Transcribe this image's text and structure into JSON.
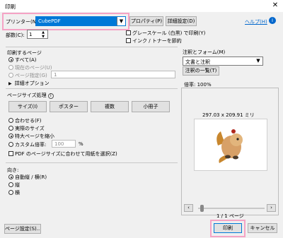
{
  "window": {
    "title": "印刷",
    "close_glyph": "✕"
  },
  "printer": {
    "label": "プリンター(N):",
    "value": "CubePDF",
    "properties": "プロパティ(P)",
    "advanced": "詳細設定(D)",
    "help": "ヘルプ(H)",
    "help_icon": "i"
  },
  "copies": {
    "label": "部数(C):",
    "value": "1"
  },
  "options": {
    "grayscale": "グレースケール (白黒) で印刷(Y)",
    "save_ink": "インク / トナーを節約"
  },
  "pages": {
    "section": "印刷するページ",
    "all": "すべて(A)",
    "current": "現在のページ(U)",
    "range": "ページ指定(G)",
    "range_value": "1",
    "more": "詳細オプション"
  },
  "sizing": {
    "section": "ページサイズ処理",
    "info_icon": "i",
    "tabs": [
      "サイズ(I)",
      "ポスター",
      "複数",
      "小冊子"
    ],
    "fit": "合わせる(F)",
    "actual": "実際のサイズ",
    "shrink": "特大ページを縮小",
    "custom": "カスタム倍率:",
    "custom_value": "100",
    "percent": "%",
    "pdf_paper": "PDF のページサイズに合わせて用紙を選択(Z)"
  },
  "orientation": {
    "section": "向き:",
    "auto": "自動縦 / 横(R)",
    "portrait": "縦",
    "landscape": "横"
  },
  "comments": {
    "label": "注釈とフォーム(M)",
    "value": "文書と注釈",
    "summary": "注釈の一覧(T)"
  },
  "preview": {
    "zoom": "倍率: 100%",
    "dimensions": "297.03 x 209.91 ミリ",
    "page_count": "1 / 1 ページ",
    "prev": "‹",
    "next": "›"
  },
  "footer": {
    "page_setup": "ページ設定(S)...",
    "print": "印刷",
    "cancel": "キャンセル"
  },
  "colors": {
    "highlight": "#f5a3c5",
    "selection": "#0078d7",
    "link": "#0066cc"
  }
}
